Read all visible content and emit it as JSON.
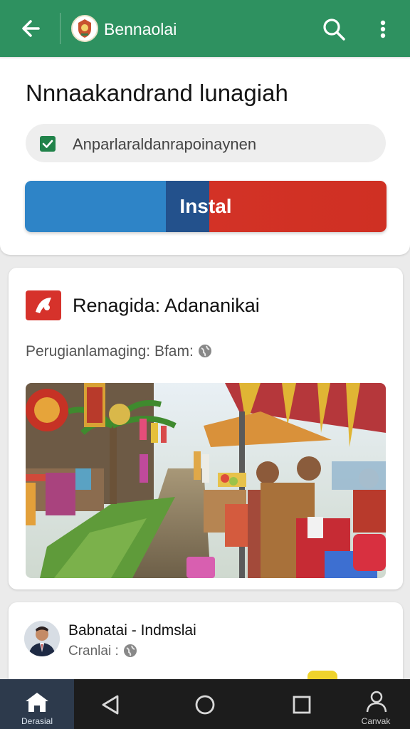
{
  "app_bar": {
    "title": "Bennaolai",
    "icons": [
      "back-arrow-icon",
      "app-logo",
      "search-icon",
      "more-vertical-icon"
    ]
  },
  "install_card": {
    "heading": "Nnnaakandrand lunagiah",
    "checkbox_label": "Anparlaraldanrapoinaynen",
    "checkbox_checked": true,
    "install_label": "Instal",
    "install_colors": [
      "#2e84c7",
      "#23518c",
      "#d33226"
    ]
  },
  "post_card": {
    "app_name": "Renagida: Adananikai",
    "meta_label": "Perugianlamaging: Bfam:",
    "meta_icon": "globe-icon",
    "image_description_icon": "market-photo"
  },
  "author_card": {
    "name": "Babnatai - Indmslai",
    "meta_label": "Cranlai :",
    "meta_icon": "globe-icon"
  },
  "bottom_nav": {
    "home_label": "Derasial",
    "account_label": "Canvak",
    "icons": [
      "home-icon",
      "back-triangle-icon",
      "home-circle-icon",
      "recents-square-icon",
      "account-icon"
    ]
  },
  "colors": {
    "app_bar": "#2e9160",
    "checkbox": "#21834a",
    "brand_red": "#d6322b"
  }
}
